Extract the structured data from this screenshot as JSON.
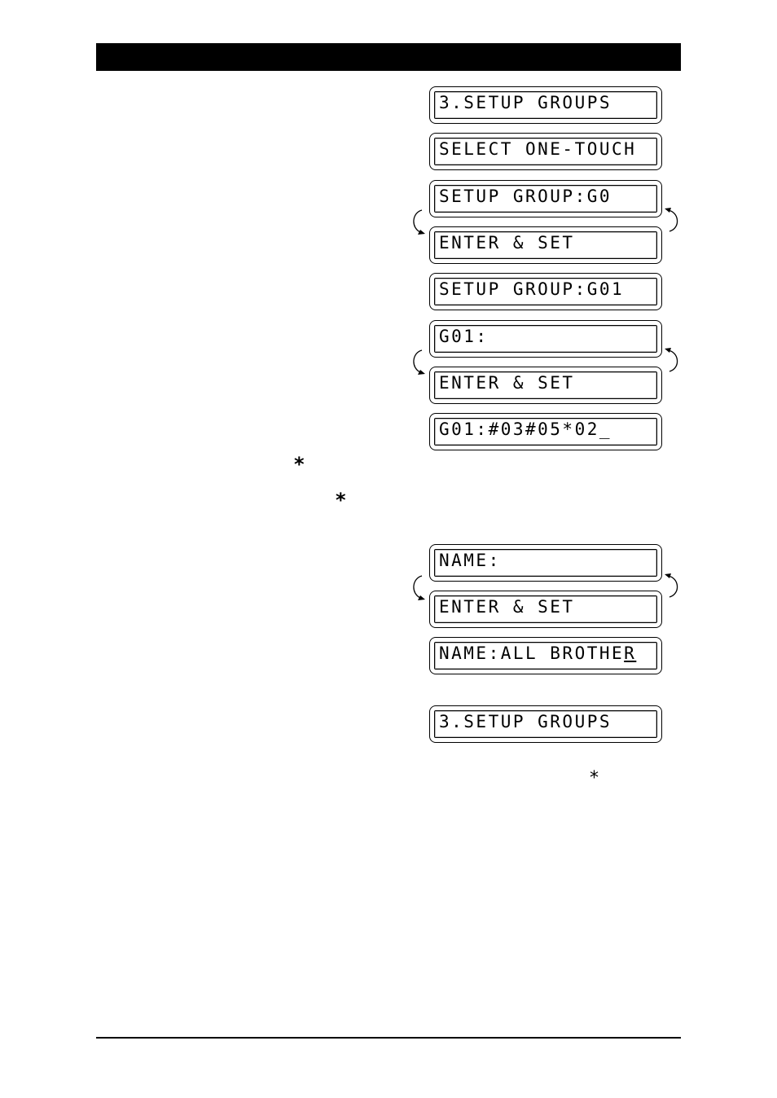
{
  "page": {
    "header_bar_color": "#000000"
  },
  "lcd_displays": [
    {
      "text": "3.SETUP GROUPS"
    },
    {
      "text": "SELECT ONE-TOUCH"
    },
    {
      "text": "SETUP GROUP:G0"
    },
    {
      "text": "ENTER & SET"
    },
    {
      "text": "SETUP GROUP:G01"
    },
    {
      "text": "G01:"
    },
    {
      "text": "ENTER & SET"
    },
    {
      "text": "G01:#03#05*02_"
    },
    {
      "text": "NAME:"
    },
    {
      "text": "ENTER & SET"
    },
    {
      "text": "NAME:ALL BROTHE",
      "cursor_char": "R"
    },
    {
      "text": "3.SETUP GROUPS"
    }
  ],
  "alternating_pairs": [
    {
      "displays": [
        "SETUP GROUP:G0",
        "ENTER & SET"
      ],
      "icon": "alternate-loop-icon"
    },
    {
      "displays": [
        "G01:",
        "ENTER & SET"
      ],
      "icon": "alternate-loop-icon"
    },
    {
      "displays": [
        "NAME:",
        "ENTER & SET"
      ],
      "icon": "alternate-loop-icon"
    }
  ],
  "symbols": {
    "asterisk_1": "*",
    "asterisk_2": "*",
    "asterisk_3": "*"
  }
}
